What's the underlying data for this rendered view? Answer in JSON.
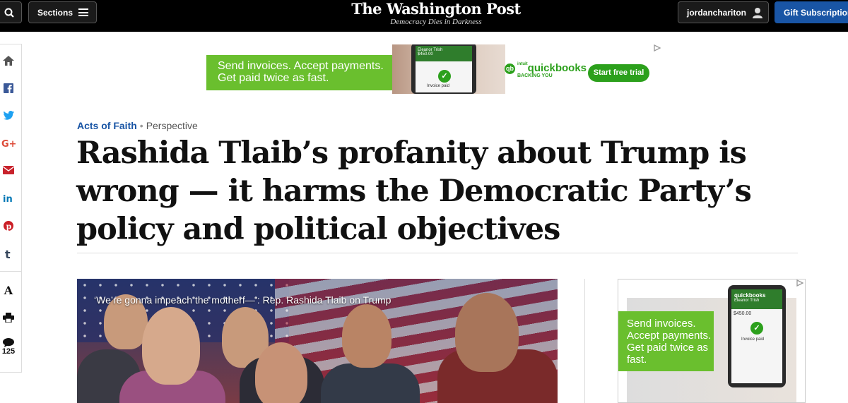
{
  "topbar": {
    "sections_label": "Sections",
    "logo": "The Washington Post",
    "tagline": "Democracy Dies in Darkness",
    "username": "jordanchariton",
    "gift_label": "Gift Subscriptions"
  },
  "share_rail": {
    "items": [
      "home-icon",
      "facebook-icon",
      "twitter-icon",
      "google-plus-icon",
      "email-icon",
      "linkedin-icon",
      "pinterest-icon",
      "tumblr-icon",
      "text-size-icon",
      "print-icon",
      "comments-icon"
    ],
    "text_size_label": "A",
    "comment_count": "125"
  },
  "ad_top": {
    "line1": "Send invoices. Accept payments.",
    "line2": "Get paid twice as fast.",
    "phone_name": "Eleanor Trish",
    "phone_amount": "$450.00",
    "invoice_status": "Invoice paid",
    "brand_prefix": "intuit",
    "brand": "quickbooks",
    "brand_tag": "BACKING YOU",
    "cta": "Start free trial"
  },
  "article": {
    "section": "Acts of Faith",
    "type": "Perspective",
    "headline": "Rashida Tlaib’s profanity about Trump is wrong — it harms the Democratic Party’s policy and political objectives"
  },
  "video": {
    "caption": "‘We’re gonna impeach the motherf—’: Rep. Rashida Tlaib on Trump"
  },
  "ad_side": {
    "text": "Send invoices. Accept payments. Get paid twice as fast.",
    "brand": "quickbooks",
    "phone_name": "Eleanor Trish",
    "phone_amount": "$450.00",
    "invoice_status": "Invoice paid"
  },
  "colors": {
    "accent_blue": "#1955a5",
    "quickbooks_green": "#2ca01c",
    "ad_green": "#6abf2e"
  }
}
